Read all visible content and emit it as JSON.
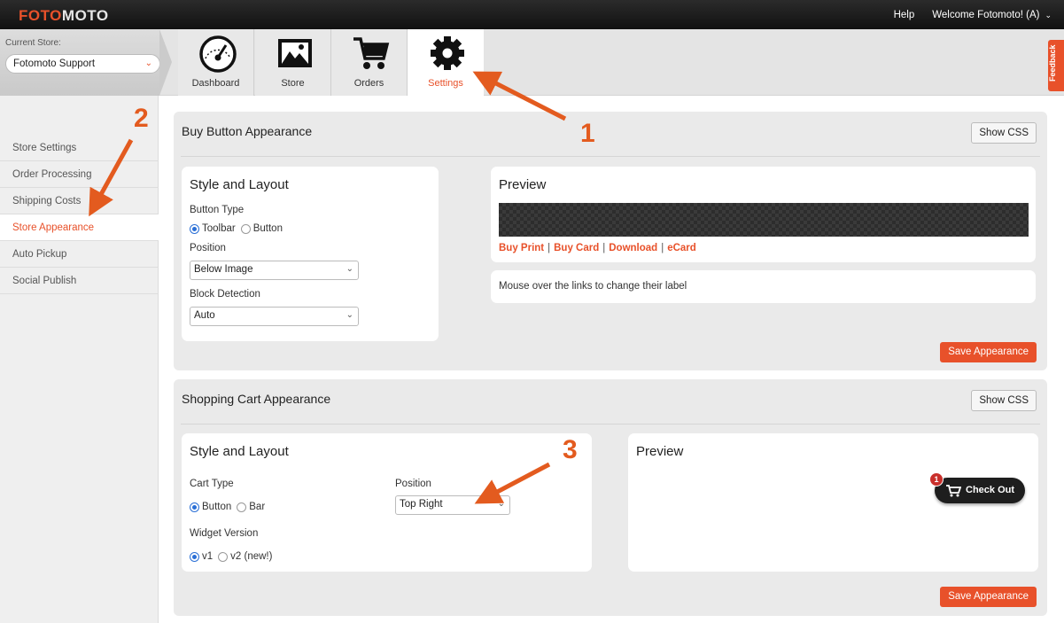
{
  "app": {
    "logo_left": "FOTO",
    "logo_right": "MOTO"
  },
  "topnav": {
    "help": "Help",
    "welcome": "Welcome Fotomoto! (A)",
    "welcome_chevron": "⌄"
  },
  "store": {
    "label": "Current Store:",
    "value": "Fotomoto Support",
    "chevron": "⌄"
  },
  "tabs": [
    {
      "label": "Dashboard",
      "icon": "dashboard-gauge-icon",
      "active": false
    },
    {
      "label": "Store",
      "icon": "photos-icon",
      "active": false
    },
    {
      "label": "Orders",
      "icon": "cart-icon",
      "active": false
    },
    {
      "label": "Settings",
      "icon": "gear-icon",
      "active": true
    }
  ],
  "feedback": "Feedback",
  "sidebar": {
    "items": [
      {
        "label": "Store Settings"
      },
      {
        "label": "Order Processing"
      },
      {
        "label": "Shipping Costs"
      },
      {
        "label": "Store Appearance",
        "active": true
      },
      {
        "label": "Auto Pickup"
      },
      {
        "label": "Social Publish"
      }
    ]
  },
  "buy_button": {
    "title": "Buy Button Appearance",
    "show_css": "Show CSS",
    "style_title": "Style and Layout",
    "button_type_label": "Button Type",
    "button_type_options": [
      "Toolbar",
      "Button"
    ],
    "button_type_selected": "Toolbar",
    "position_label": "Position",
    "position_value": "Below Image",
    "block_label": "Block Detection",
    "block_value": "Auto",
    "preview_title": "Preview",
    "preview_links": [
      "Buy Print",
      "Buy Card",
      "Download",
      "eCard"
    ],
    "link_separator": "|",
    "hint": "Mouse over the links to change their label",
    "save": "Save Appearance"
  },
  "cart": {
    "title": "Shopping Cart Appearance",
    "show_css": "Show CSS",
    "style_title": "Style and Layout",
    "cart_type_label": "Cart Type",
    "cart_type_options": [
      "Button",
      "Bar"
    ],
    "cart_type_selected": "Button",
    "position_label": "Position",
    "position_value": "Top Right",
    "widget_label": "Widget Version",
    "widget_options": [
      "v1",
      "v2 (new!)"
    ],
    "widget_selected": "v1",
    "preview_title": "Preview",
    "checkout_label": "Check Out",
    "checkout_badge": "1",
    "save": "Save Appearance"
  },
  "annotations": {
    "n1": "1",
    "n2": "2",
    "n3": "3",
    "color": "#e35b1f"
  },
  "colors": {
    "accent": "#e8512a",
    "topbar": "#1a1a1a",
    "panel": "#eaeaea"
  }
}
